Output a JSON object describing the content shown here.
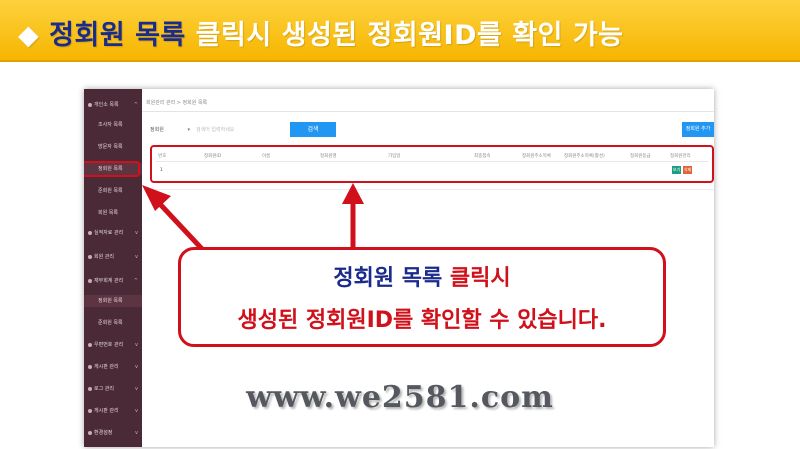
{
  "banner": {
    "bullet": "◆ ",
    "highlight": "정회원 목록",
    "rest": " 클릭시 생성된 정회원ID를 확인 가능"
  },
  "screenshot": {
    "sidebar": {
      "items": [
        {
          "label": "개인소 목록",
          "kind": "group"
        },
        {
          "label": "조사자 목록",
          "kind": "sub"
        },
        {
          "label": "방문자 목록",
          "kind": "sub"
        },
        {
          "label": "정회원 목록",
          "kind": "sub"
        },
        {
          "label": "준회원 목록",
          "kind": "sub"
        },
        {
          "label": "회원 목록",
          "kind": "sub"
        },
        {
          "label": "실적자료 관리",
          "kind": "group"
        },
        {
          "label": "회원 관리",
          "kind": "group"
        },
        {
          "label": "재무회계 관리",
          "kind": "group"
        },
        {
          "label": "정회원 목록",
          "kind": "sub"
        },
        {
          "label": "준회원 목록",
          "kind": "sub"
        },
        {
          "label": "우편번호 관리",
          "kind": "group"
        },
        {
          "label": "게시판 관리",
          "kind": "group"
        },
        {
          "label": "로그 관리",
          "kind": "group"
        },
        {
          "label": "게시판 관리",
          "kind": "group"
        },
        {
          "label": "환경설정",
          "kind": "group"
        }
      ]
    },
    "breadcrumb": "회원관리 관리 > 정회원 목록",
    "search": {
      "select_value": "정회원",
      "placeholder": "검색어 입력하세요",
      "button_label": "검색"
    },
    "register_button": "정회원 추가",
    "table": {
      "headers": [
        "번호",
        "정회원ID",
        "이름",
        "정회원명",
        "가입일",
        "최종접속",
        "정회원주소목록",
        "정회원주소목록(활성)",
        "정회원등급",
        "정회원관리"
      ],
      "rows": [
        {
          "no": "1",
          "edit": "보기",
          "delete": "삭제"
        }
      ]
    }
  },
  "callout": {
    "line1_blue": "정회원 목록",
    "line1_red": " 클릭시",
    "line2": "생성된 정회원ID를 확인할 수 있습니다."
  },
  "url": "www.we2581.com",
  "colors": {
    "banner": "#f7b500",
    "sidebar": "#4a2a36",
    "accent_red": "#d0101a",
    "navy": "#1a2b8c",
    "button_blue": "#2196f3"
  }
}
